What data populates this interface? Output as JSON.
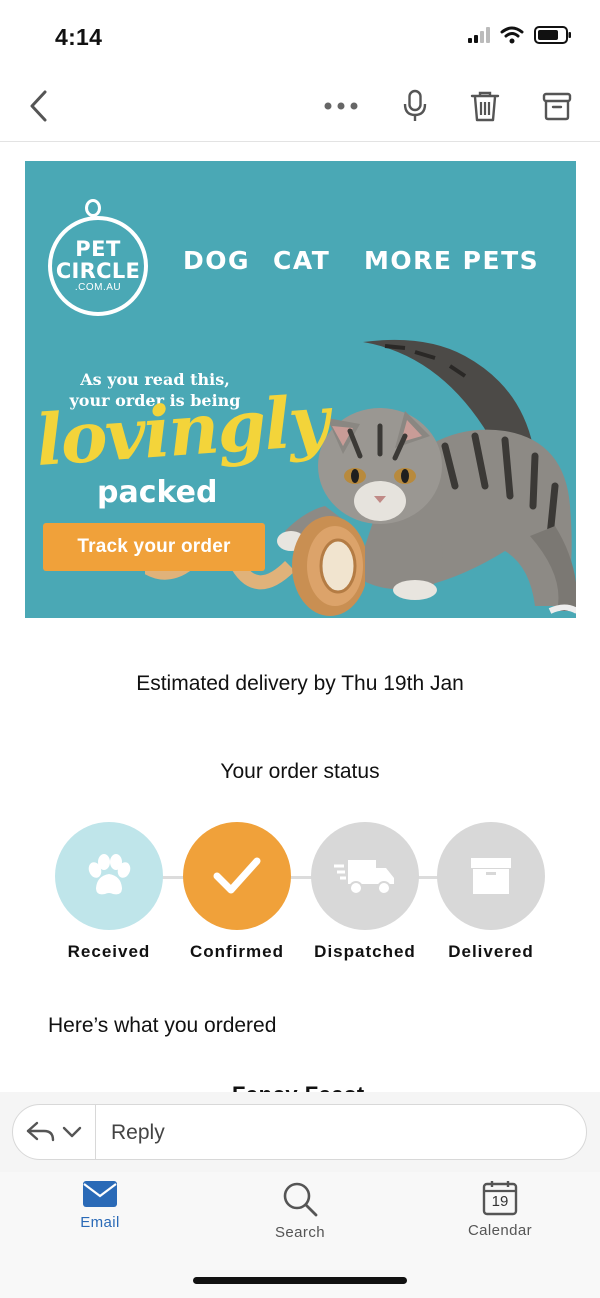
{
  "status_bar": {
    "time": "4:14"
  },
  "banner": {
    "logo": {
      "line1": "PET",
      "line2": "CIRCLE",
      "line3": ".COM.AU"
    },
    "nav": [
      "DOG",
      "CAT",
      "MORE PETS"
    ],
    "tagline": "As you read this, your order is being",
    "script_word": "lovingly",
    "packed": "packed",
    "cta": "Track your order",
    "bg_color": "#4aa8b5"
  },
  "delivery_text": "Estimated delivery by Thu 19th Jan",
  "order_status": {
    "title": "Your order status",
    "steps": [
      {
        "label": "Received",
        "icon": "paw-icon",
        "color": "#bfe5ea",
        "state": "done"
      },
      {
        "label": "Confirmed",
        "icon": "checkmark-icon",
        "color": "#f0a13a",
        "state": "current"
      },
      {
        "label": "Dispatched",
        "icon": "truck-icon",
        "color": "#d8d8d8",
        "state": "pending"
      },
      {
        "label": "Delivered",
        "icon": "box-icon",
        "color": "#d8d8d8",
        "state": "pending"
      }
    ]
  },
  "ordered_heading": "Here’s what you ordered",
  "cutoff_text": "Fancy Feast",
  "reply": {
    "placeholder": "Reply"
  },
  "tabbar": {
    "items": [
      {
        "label": "Email",
        "icon": "envelope-icon",
        "active": true
      },
      {
        "label": "Search",
        "icon": "search-icon",
        "active": false
      },
      {
        "label": "Calendar",
        "icon": "calendar-icon",
        "active": false,
        "day": "19"
      }
    ],
    "accent": "#2a6ab7"
  }
}
